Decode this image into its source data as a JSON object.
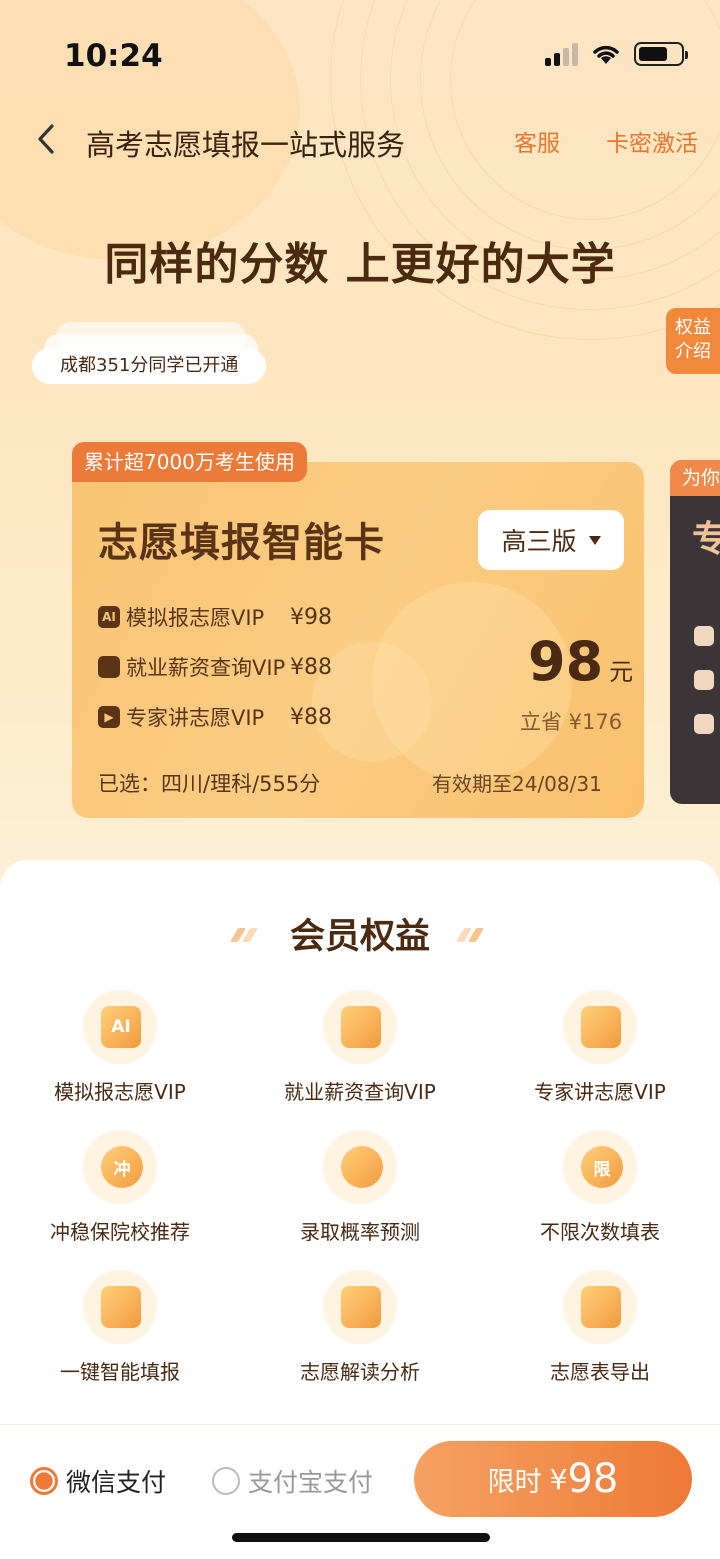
{
  "status": {
    "time": "10:24"
  },
  "nav": {
    "title": "高考志愿填报一站式服务",
    "service": "客服",
    "activate": "卡密激活"
  },
  "headline": "同样的分数 上更好的大学",
  "ticker": {
    "current": "成都351分同学已开通"
  },
  "side_tab": {
    "line1": "权益",
    "line2": "介绍"
  },
  "card": {
    "badge": "累计超7000万考生使用",
    "title": "志愿填报智能卡",
    "version": "高三版",
    "features": [
      {
        "name": "模拟报志愿VIP",
        "price": "¥98",
        "icon": "ai-icon"
      },
      {
        "name": "就业薪资查询VIP",
        "price": "¥88",
        "icon": "briefcase-icon"
      },
      {
        "name": "专家讲志愿VIP",
        "price": "¥88",
        "icon": "video-play-icon"
      }
    ],
    "price": "98",
    "unit": "元",
    "save": "立省 ¥176",
    "selected": "已选：四川/理科/555分",
    "expiry": "有效期至24/08/31"
  },
  "peek_card": {
    "tag": "为你",
    "big": "专"
  },
  "benefits": {
    "title": "会员权益",
    "items": [
      {
        "label": "模拟报志愿VIP",
        "glyph": "AI",
        "icon": "ai-doc-icon"
      },
      {
        "label": "就业薪资查询VIP",
        "glyph": "",
        "icon": "briefcase-icon"
      },
      {
        "label": "专家讲志愿VIP",
        "glyph": "",
        "icon": "presentation-icon"
      },
      {
        "label": "冲稳保院校推荐",
        "glyph": "冲",
        "icon": "chong-icon"
      },
      {
        "label": "录取概率预测",
        "glyph": "",
        "icon": "pie-chart-icon"
      },
      {
        "label": "不限次数填表",
        "glyph": "限",
        "icon": "unlimited-icon"
      },
      {
        "label": "一键智能填报",
        "glyph": "",
        "icon": "document-icon"
      },
      {
        "label": "志愿解读分析",
        "glyph": "",
        "icon": "book-icon"
      },
      {
        "label": "志愿表导出",
        "glyph": "",
        "icon": "printer-icon"
      }
    ]
  },
  "payment": {
    "wechat": "微信支付",
    "alipay": "支付宝支付"
  },
  "buy": {
    "prefix": "限时",
    "currency": "¥",
    "amount": "98"
  },
  "colors": {
    "accent": "#ee7a36",
    "card": "#f9c475",
    "text": "#4a2a12"
  }
}
